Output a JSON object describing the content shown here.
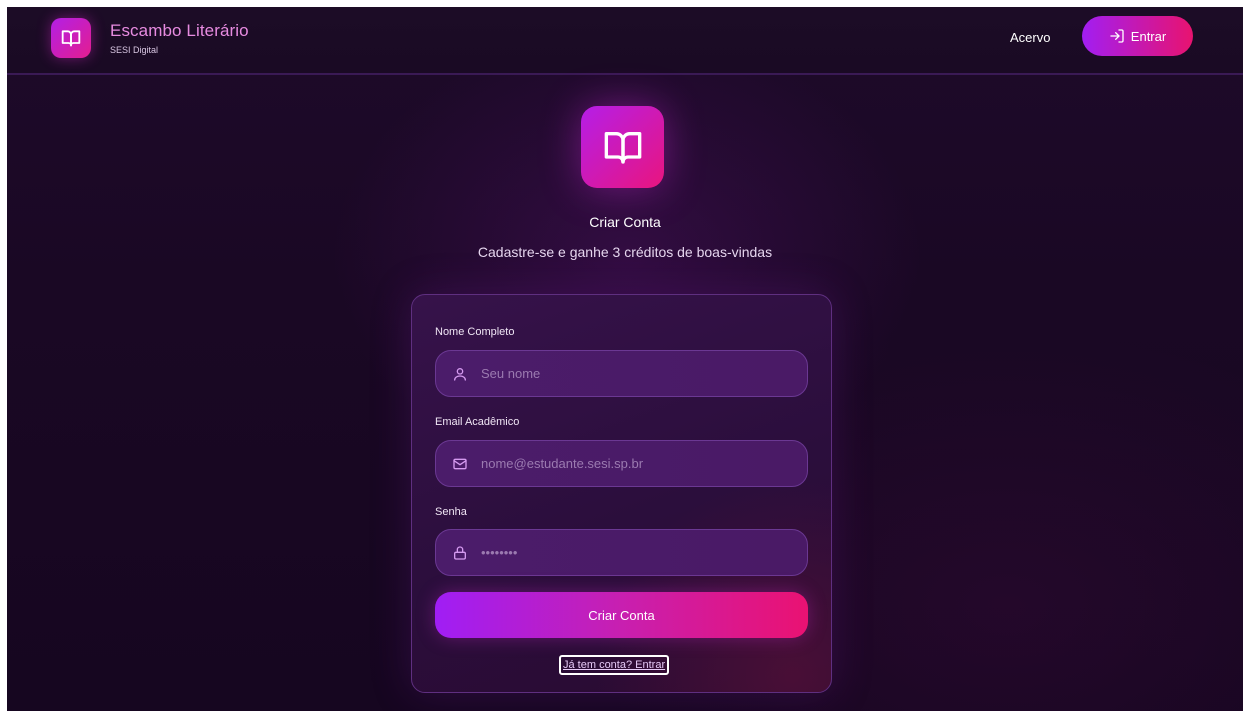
{
  "header": {
    "brand_title": "Escambo Literário",
    "brand_subtitle": "SESI Digital",
    "nav_link": "Acervo",
    "enter_button": "Entrar"
  },
  "hero": {
    "title": "Criar Conta",
    "subtitle": "Cadastre-se e ganhe 3 créditos de boas-vindas"
  },
  "form": {
    "name": {
      "label": "Nome Completo",
      "placeholder": "Seu nome",
      "value": "",
      "icon": "user-icon"
    },
    "email": {
      "label": "Email Acadêmico",
      "placeholder": "nome@estudante.sesi.sp.br",
      "value": "",
      "icon": "mail-icon"
    },
    "password": {
      "label": "Senha",
      "placeholder": "••••••••",
      "value": "",
      "icon": "lock-icon"
    },
    "submit_label": "Criar Conta",
    "login_link": "Já tem conta? Entrar"
  },
  "colors": {
    "accent_start": "#a21ef2",
    "accent_end": "#e8136f",
    "background": "#1a0824",
    "brand_title": "#e78be0"
  }
}
